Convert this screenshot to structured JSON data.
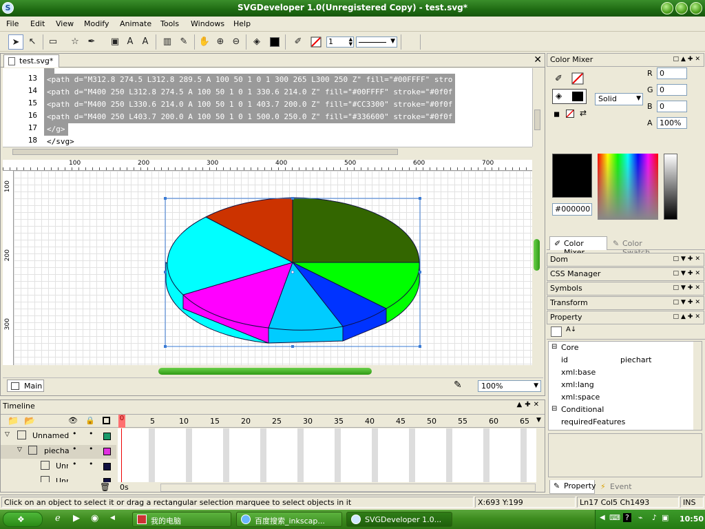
{
  "window": {
    "title": "SVGDeveloper 1.0(Unregistered Copy) - test.svg*"
  },
  "menu": [
    "File",
    "Edit",
    "View",
    "Modify",
    "Animate",
    "Tools",
    "Windows",
    "Help"
  ],
  "toolbar": {
    "stroke_width": "1"
  },
  "doc_tab": "test.svg*",
  "code_lines": [
    {
      "n": "13",
      "text": "<path d=\"M312.8 274.5 L312.8 289.5 A 100 50 1 0 1 300 265 L300 250 Z\" fill=\"#00FFFF\" stro"
    },
    {
      "n": "14",
      "text": "<path d=\"M400 250 L312.8 274.5 A 100 50 1 0 1 330.6 214.0 Z\" fill=\"#00FFFF\" stroke=\"#0f0f"
    },
    {
      "n": "15",
      "text": "<path d=\"M400 250 L330.6 214.0 A 100 50 1 0 1 403.7 200.0 Z\" fill=\"#CC3300\" stroke=\"#0f0f"
    },
    {
      "n": "16",
      "text": "<path d=\"M400 250 L403.7 200.0 A 100 50 1 0 1 500.0 250.0 Z\" fill=\"#336600\" stroke=\"#0f0f"
    },
    {
      "n": "17",
      "text": "</g>"
    },
    {
      "n": "18",
      "text": "</svg>"
    }
  ],
  "ruler": {
    "top": [
      "100",
      "200",
      "300",
      "400",
      "500",
      "600",
      "700"
    ],
    "left": [
      "100",
      "200",
      "300"
    ]
  },
  "pie": {
    "colors": {
      "dark_green": "#336600",
      "green": "#00FF00",
      "blue": "#0033FF",
      "cyan": "#00FFFF",
      "magenta": "#FF00FF",
      "red": "#CC3300",
      "light_blue": "#00CCFF"
    }
  },
  "doc_status": {
    "scene": "Main",
    "zoom": "100%"
  },
  "timeline": {
    "title": "Timeline",
    "frames": [
      "5",
      "10",
      "15",
      "20",
      "25",
      "30",
      "35",
      "40",
      "45",
      "50",
      "55",
      "60",
      "65"
    ],
    "current_frame": "0",
    "time": "0s",
    "layers": [
      {
        "name": "Unnamed",
        "color": "#1a9a6a"
      },
      {
        "name": "piechar",
        "color": "#e030e0"
      },
      {
        "name": "Unr",
        "color": "#101040"
      },
      {
        "name": "Unr",
        "color": "#101040"
      }
    ]
  },
  "status": {
    "message": "Click on an object to select it or drag a rectangular selection marquee to select objects in it",
    "coords": "X:693 Y:199",
    "cursor": "Ln17  Col5  Ch1493",
    "mode": "INS"
  },
  "color_mixer": {
    "title": "Color Mixer",
    "fill_type": "Solid",
    "R": "0",
    "G": "0",
    "B": "0",
    "A": "100%",
    "hex": "#000000",
    "tabs": [
      "Color Mixer",
      "Color Swatch"
    ]
  },
  "panels": [
    "Dom",
    "CSS Manager",
    "Symbols",
    "Transform",
    "Property"
  ],
  "property": {
    "groups": [
      {
        "name": "Core",
        "rows": [
          {
            "k": "id",
            "v": "piechart"
          },
          {
            "k": "xml:base",
            "v": ""
          },
          {
            "k": "xml:lang",
            "v": ""
          },
          {
            "k": "xml:space",
            "v": ""
          }
        ]
      },
      {
        "name": "Conditional",
        "rows": [
          {
            "k": "requiredFeatures",
            "v": ""
          }
        ]
      }
    ],
    "tabs": [
      "Property",
      "Event"
    ]
  },
  "taskbar": {
    "tasks": [
      "我的电脑",
      "百度搜索_inkscap...",
      "SVGDeveloper 1.0..."
    ],
    "clock": "10:50"
  }
}
